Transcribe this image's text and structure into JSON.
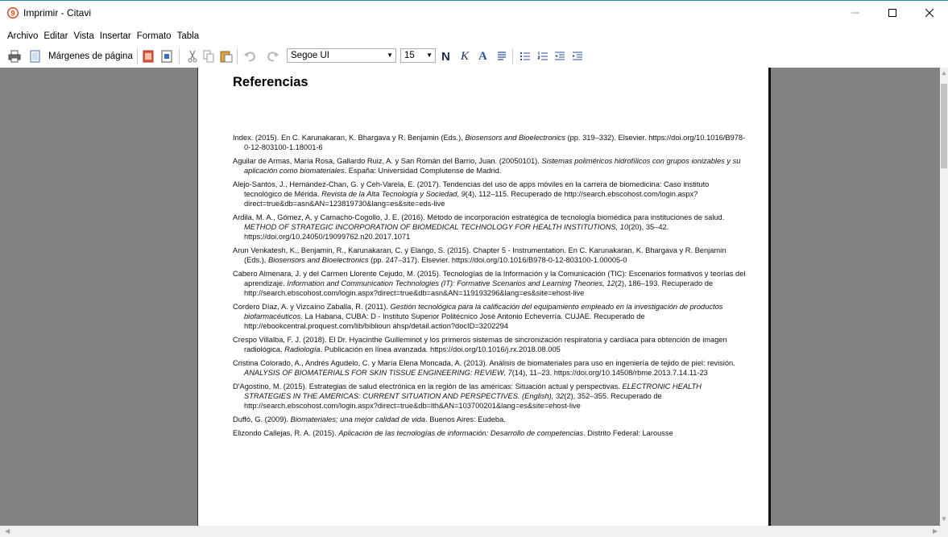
{
  "window": {
    "title": "Imprimir - Citavi"
  },
  "menu": [
    "Archivo",
    "Editar",
    "Vista",
    "Insertar",
    "Formato",
    "Tabla"
  ],
  "toolbar": {
    "margins_label": "Márgenes de página",
    "font_name": "Segoe UI",
    "font_size": "15",
    "bold_label": "N",
    "italic_label": "K",
    "color_label": "A"
  },
  "document": {
    "heading": "Referencias",
    "references": [
      {
        "pre": "Index. (2015). En C. Karunakaran, K. Bhargava y R. Benjamin (Eds.), ",
        "it": "Biosensors and Bioelectronics",
        "post": " (pp. 319–332). Elsevier. https://doi.org/10.1016/B978-0-12-803100-1.18001-6"
      },
      {
        "pre": "Aguilar de Armas, María Rosa, Gallardo Ruiz, A. y San Román del Barrio, Juan. (20050101). ",
        "it": "Sistemas poliméricos hidrofílicos con grupos ionizables y su aplicación como biomateriales",
        "post": ". España: Universidad Complutense de Madrid."
      },
      {
        "pre": "Alejo-Santos, J., Hernández-Chan, G. y Ceh-Varela, E. (2017). Tendencias del uso de apps móviles en la carrera de biomedicina: Caso instituto tecnológico de Mérida. ",
        "it": "Revista de la Alta Tecnología y Sociedad, 9",
        "post": "(4), 112–115. Recuperado de http://search.ebscohost.com/login.aspx?direct=true&db=asn&AN=123819730&lang=es&site=eds-live"
      },
      {
        "pre": "Ardila, M. A., Gómez, A. y Camacho-Cogollo, J. E. (2016). Método de incorporación estratégica de tecnología biomédica para instituciones de salud. ",
        "it": "METHOD OF STRATEGIC INCORPORATION OF BIOMEDICAL TECHNOLOGY FOR HEALTH INSTITUTIONS, 10",
        "post": "(20), 35–42. https://doi.org/10.24050/19099762.n20.2017.1071"
      },
      {
        "pre": "Arun Venkatesh, K., Benjamin, R., Karunakaran, C. y Elango, S. (2015). Chapter 5 - Instrumentation. En C. Karunakaran, K. Bhargava y R. Benjamin (Eds.), ",
        "it": "Biosensors and Bioelectronics",
        "post": " (pp. 247–317). Elsevier. https://doi.org/10.1016/B978-0-12-803100-1.00005-0"
      },
      {
        "pre": "Cabero Almenara, J. y del Carmen Llorente Cejudo, M. (2015). Tecnologías de la Información y la Comunicación (TIC): Escenarios formativos y teorías del aprendizaje. ",
        "it": "Information and Communication Technologies (IT): Formative Scenarios and Learning Theories, 12",
        "post": "(2), 186–193. Recuperado de http://search.ebscohost.com/login.aspx?direct=true&db=asn&AN=119193296&lang=es&site=ehost-live"
      },
      {
        "pre": "Cordero Díaz, A. y Vizcaíno Zaballa, R. (2011). ",
        "it": "Gestión tecnológica para la calificación del equipamiento empleado en la investigación de productos biofarmacéuticos",
        "post": ". La Habana, CUBA: D - Instituto Superior Politécnico José Antonio Echeverría. CUJAE. Recuperado de http://ebookcentral.proquest.com/lib/biblioun ahsp/detail.action?docID=3202294"
      },
      {
        "pre": "Crespo Villalba, F. J. (2018). El Dr. Hyacinthe Guilleminot y los primeros sistemas de sincronización respiratoria y cardíaca para obtención de imagen radiológica. ",
        "it": "Radiología",
        "post": ". Publicación en línea avanzada. https://doi.org/10.1016/j.rx.2018.08.005"
      },
      {
        "pre": "Cristina Colorado, A., Andrés Agudelo, C. y María Elena Moncada, A. (2013). Análisis de biomateriales para uso en ingeniería de tejido de piel: revisión. ",
        "it": "ANALYSIS OF BIOMATERIALS FOR SKIN TISSUE ENGINEERING: REVIEW, 7",
        "post": "(14), 11–23. https://doi.org/10.14508/rbme.2013.7.14.11-23"
      },
      {
        "pre": "D'Agostino, M. (2015). Estrategias de salud electrónica en la región de las américas: Situación actual y perspectivas. ",
        "it": "ELECTRONIC HEALTH STRATEGIES IN THE AMERICAS: CURRENT SITUATION AND PERSPECTIVES. (English), 32",
        "post": "(2), 352–355. Recuperado de http://search.ebscohost.com/login.aspx?direct=true&db=lth&AN=103700201&lang=es&site=ehost-live"
      },
      {
        "pre": "Duffó, G. (2009). ",
        "it": "Biomateriales; una mejor calidad de vida",
        "post": ". Buenos Aires: Eudeba."
      },
      {
        "pre": "Elizondo Callejas, R. A. (2015). ",
        "it": "Aplicación de las tecnologías de información: Desarrollo de competencias",
        "post": ". Distrito Federal: Larousse"
      }
    ]
  },
  "colors": {
    "accent": "#2b84c6",
    "workspace": "#828282",
    "citavi_red": "#e8491d"
  },
  "icons": [
    "citavi-logo-icon",
    "printer-icon",
    "page-icon",
    "pdf-icon",
    "export-icon",
    "cut-icon",
    "copy-icon",
    "paste-icon",
    "undo-icon",
    "redo-icon",
    "align-justify-icon",
    "bullet-list-icon",
    "numbered-list-icon",
    "decrease-indent-icon",
    "increase-indent-icon"
  ]
}
